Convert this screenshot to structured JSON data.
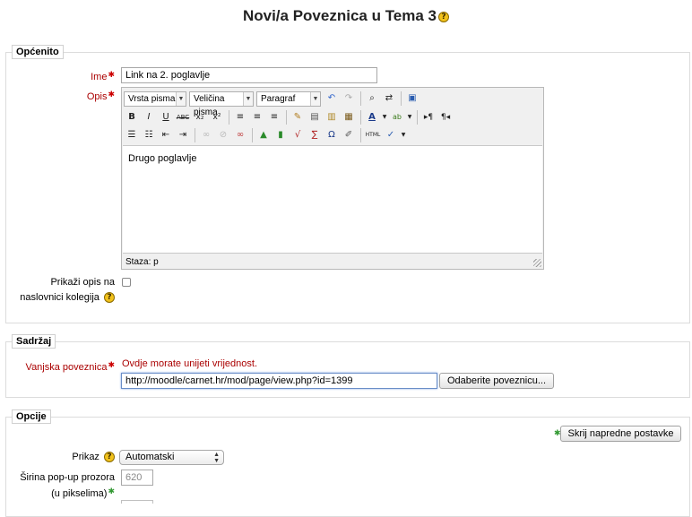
{
  "page": {
    "title": "Novi/a Poveznica u Tema 3"
  },
  "general": {
    "legend": "Općenito",
    "name_label": "Ime",
    "name_value": "Link na 2. poglavlje",
    "description_label": "Opis",
    "editor": {
      "font_family": "Vrsta pisma",
      "font_size": "Veličina pisma",
      "format": "Paragraf",
      "content": "Drugo poglavlje",
      "status_path": "Staza: p"
    },
    "show_description_label_1": "Prikaži opis na",
    "show_description_label_2": "naslovnici kolegija"
  },
  "content": {
    "legend": "Sadržaj",
    "url_label": "Vanjska poveznica",
    "error": "Ovdje morate unijeti vrijednost.",
    "url_value": "http://moodle/carnet.hr/mod/page/view.php?id=1399",
    "choose_link_button": "Odaberite poveznicu..."
  },
  "options": {
    "legend": "Opcije",
    "hide_advanced_button": "Skrij napredne postavke",
    "display_label": "Prikaz",
    "display_value": "Automatski",
    "popup_width_label_1": "Širina pop-up prozora",
    "popup_width_label_2": "(u pikselima)",
    "popup_width_value": "620"
  },
  "colors": {
    "required": "#cc0000",
    "advanced": "#339933",
    "help": "#f2c21b"
  }
}
